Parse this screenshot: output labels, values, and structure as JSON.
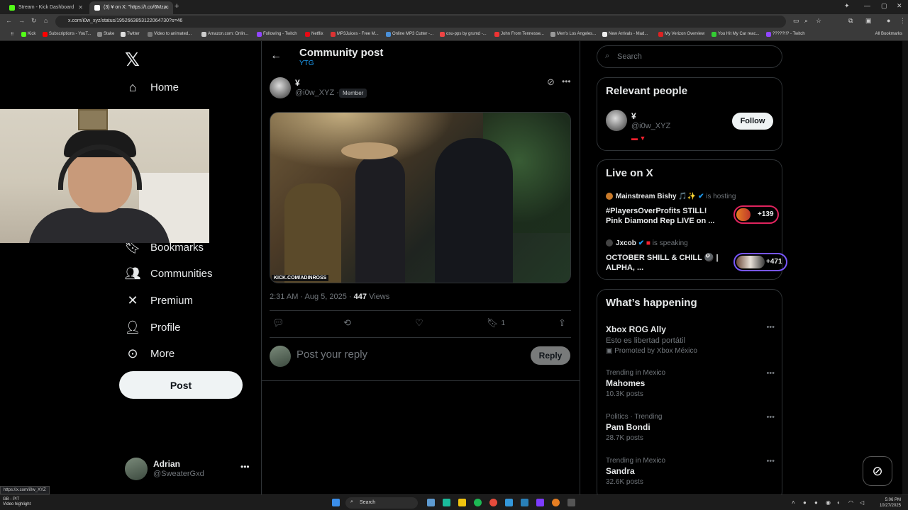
{
  "browser": {
    "tabs": [
      {
        "label": "Stream - Kick Dashboard",
        "icon_color": "#53fc18"
      },
      {
        "label": "(3) ¥ on X: \"https://t.co/6Mzzc",
        "icon_color": "#ffffff"
      }
    ],
    "url": "x.com/i0w_xyz/status/1952663853122064730?s=46",
    "bookmarks": [
      "Kick",
      "Subscriptions - YouT...",
      "Stake",
      "Twitter",
      "Video to animated...",
      "Amazon.com: Onlin...",
      "Following - Twitch",
      "Netflix",
      "MP3Juices - Free M...",
      "Online MP3 Cutter -...",
      "osu-pps by grumd -...",
      "John From Tennesse...",
      "Men's Los Angeles...",
      "New Arrivals - Mad...",
      "My Verizon Overview",
      "You Hit My Car reac...",
      "?????!!? - Twitch"
    ],
    "all_bookmarks": "All Bookmarks",
    "status_url": "https://x.com/i0w_XYZ"
  },
  "sidebar": {
    "nav": [
      {
        "label": "Home",
        "icon": "home-icon"
      },
      {
        "label": "Bookmarks",
        "icon": "bookmark-icon"
      },
      {
        "label": "Communities",
        "icon": "communities-icon"
      },
      {
        "label": "Premium",
        "icon": "x-premium-icon"
      },
      {
        "label": "Profile",
        "icon": "profile-icon"
      },
      {
        "label": "More",
        "icon": "more-icon"
      }
    ],
    "post_button": "Post",
    "account": {
      "name": "Adrian",
      "handle": "@SweaterGxd"
    }
  },
  "main": {
    "title": "Community post",
    "subtitle": "YTG",
    "post": {
      "author_name": "¥",
      "author_handle": "@i0w_XYZ",
      "dot": "·",
      "badge": "Member",
      "media_watermark": "KICK.COM/ADINROSS",
      "time": "2:31 AM · Aug 5, 2025 ·",
      "views_count": "447",
      "views_label": "Views",
      "bookmark_count": "1"
    },
    "reply_placeholder": "Post your reply",
    "reply_button": "Reply"
  },
  "right": {
    "search_placeholder": "Search",
    "relevant_people": {
      "title": "Relevant people",
      "name": "¥",
      "handle": "@i0w_XYZ",
      "follow": "Follow"
    },
    "live": {
      "title": "Live on X",
      "items": [
        {
          "host": "Mainstream Bishy 🎵✨",
          "status": "is hosting",
          "title": "#PlayersOverProfits STILL! Pink Diamond Rep LIVE on ...",
          "count": "+139"
        },
        {
          "host": "Jxcob",
          "status": "is speaking",
          "title": "OCTOBER SHILL & CHILL 🎱 | ALPHA, ...",
          "count": "+471"
        }
      ]
    },
    "happening": {
      "title": "What’s happening",
      "promoted": {
        "title": "Xbox ROG Ally",
        "desc": "Esto es libertad portátil",
        "promo": "Promoted by Xbox México"
      },
      "trends": [
        {
          "context": "Trending in Mexico",
          "title": "Mahomes",
          "posts": "10.3K posts"
        },
        {
          "context": "Politics · Trending",
          "title": "Pam Bondi",
          "posts": "28.7K posts"
        },
        {
          "context": "Trending in Mexico",
          "title": "Sandra",
          "posts": "32.6K posts"
        }
      ]
    }
  },
  "taskbar": {
    "weather_line1": "GB - PIT",
    "weather_line2": "Video highlight",
    "search": "Search",
    "time": "5:06 PM",
    "date": "10/27/2025"
  },
  "colors": {
    "accent": "#1d9bf0",
    "background": "#000000",
    "border": "#2f3336",
    "muted": "#71767b"
  }
}
